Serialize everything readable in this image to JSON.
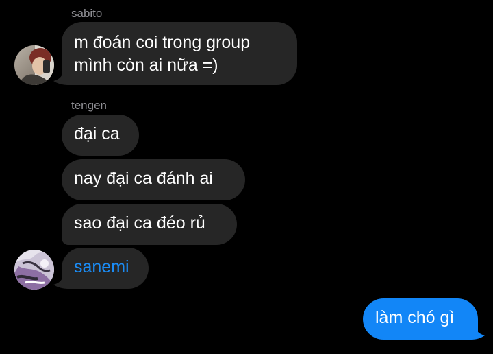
{
  "colors": {
    "background": "#000000",
    "incoming_bubble": "#262626",
    "outgoing_bubble": "#1286f7",
    "sender_name": "#8e8e93",
    "mention_link": "#1b8cf5"
  },
  "messages": {
    "group1": {
      "sender": "sabito",
      "avatar_icon": "user-avatar-sabito",
      "bubbles": [
        "m đoán coi trong group\nmình còn ai nữa =)"
      ]
    },
    "group2": {
      "sender": "tengen",
      "bubbles": [
        "đại ca",
        "nay đại ca đánh ai",
        "sao đại ca đéo rủ"
      ]
    },
    "group3": {
      "avatar_icon": "user-avatar-anime",
      "bubbles": [
        "sanemi"
      ]
    },
    "outgoing": {
      "bubbles": [
        "làm chó gì"
      ]
    }
  }
}
